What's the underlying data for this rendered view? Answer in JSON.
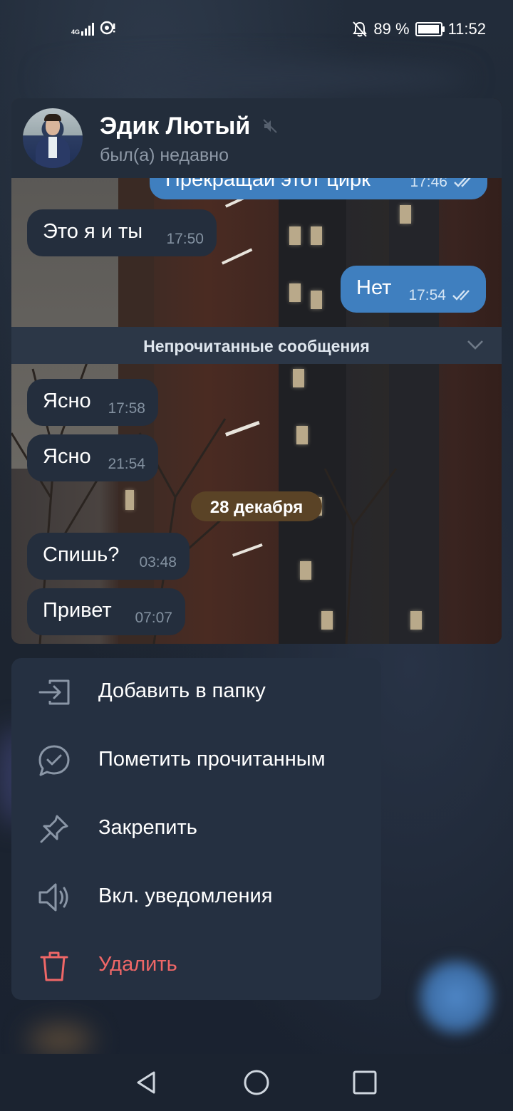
{
  "status_bar": {
    "network": "4G",
    "battery_percent": "89 %",
    "time": "11:52"
  },
  "chat": {
    "name": "Эдик Лютый",
    "status": "был(а) недавно",
    "muted": true,
    "messages": [
      {
        "dir": "out",
        "text": "Прекращай этот цирк",
        "time": "17:46",
        "read": true
      },
      {
        "dir": "in",
        "text": "Это я и ты",
        "time": "17:50"
      },
      {
        "dir": "out",
        "text": "Нет",
        "time": "17:54",
        "read": true
      },
      {
        "dir": "in",
        "text": "Ясно",
        "time": "17:58"
      },
      {
        "dir": "in",
        "text": "Ясно",
        "time": "21:54"
      },
      {
        "dir": "in",
        "text": "Спишь?",
        "time": "03:48"
      },
      {
        "dir": "in",
        "text": "Привет",
        "time": "07:07"
      }
    ],
    "unread_label": "Непрочитанные сообщения",
    "date_separator": "28 декабря"
  },
  "menu": {
    "items": [
      {
        "label": "Добавить в папку",
        "icon": "folder-add-icon"
      },
      {
        "label": "Пометить прочитанным",
        "icon": "mark-read-icon"
      },
      {
        "label": "Закрепить",
        "icon": "pin-icon"
      },
      {
        "label": "Вкл. уведомления",
        "icon": "speaker-icon"
      },
      {
        "label": "Удалить",
        "icon": "trash-icon",
        "danger": true
      }
    ]
  },
  "colors": {
    "outgoing_bubble": "#3f7fbf",
    "incoming_bubble": "#242e3d",
    "menu_background": "#253041",
    "danger": "#ef6767"
  }
}
